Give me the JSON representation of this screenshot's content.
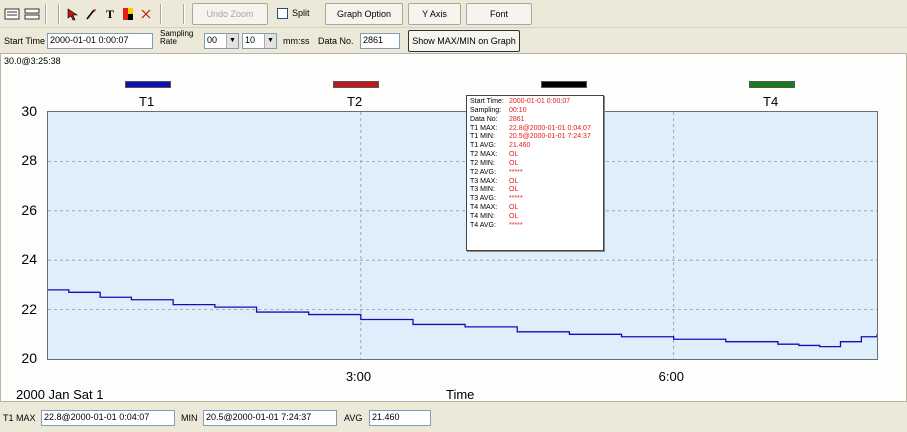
{
  "toolbar": {
    "undo_zoom": "Undo Zoom",
    "split": "Split",
    "graph_option": "Graph Option",
    "y_axis": "Y Axis",
    "font": "Font"
  },
  "settings": {
    "start_time_label": "Start Time",
    "start_time_value": "2000-01-01 0:00:07",
    "sampling_rate_label": "Sampling Rate",
    "rate_minutes": "00",
    "rate_seconds": "10",
    "rate_unit": "mm:ss",
    "data_no_label": "Data No.",
    "data_no_value": "2861",
    "show_maxmin": "Show MAX/MIN on Graph"
  },
  "graph": {
    "cursor_readout": "30.0@3:25:38",
    "legend": [
      {
        "label": "T1",
        "color": "#1010b8"
      },
      {
        "label": "T2",
        "color": "#c01818"
      },
      {
        "label": "",
        "color": "#000000"
      },
      {
        "label": "T4",
        "color": "#1b7a1b"
      }
    ],
    "date_label": "2000 Jan Sat 1",
    "x_title": "Time"
  },
  "chart_data": {
    "type": "line",
    "title": "",
    "xlabel": "Time",
    "ylabel": "",
    "ylim": [
      20,
      30
    ],
    "yticks": [
      "30",
      "28",
      "26",
      "24",
      "22",
      "20"
    ],
    "xticks": [
      "3:00",
      "6:00"
    ],
    "x_range_hours": [
      0.0,
      7.95
    ],
    "grid": true,
    "series": [
      {
        "name": "T1",
        "color": "#1010b8",
        "x_hours": [
          0.0,
          0.2,
          0.5,
          0.8,
          1.2,
          1.6,
          2.0,
          2.5,
          3.0,
          3.5,
          4.0,
          4.5,
          5.0,
          5.5,
          6.0,
          6.5,
          7.0,
          7.2,
          7.4,
          7.6,
          7.8,
          7.95
        ],
        "values": [
          22.8,
          22.7,
          22.5,
          22.4,
          22.2,
          22.1,
          21.9,
          21.8,
          21.6,
          21.4,
          21.3,
          21.1,
          21.0,
          20.9,
          20.8,
          20.7,
          20.6,
          20.55,
          20.5,
          20.7,
          20.9,
          21.0
        ]
      }
    ]
  },
  "popup": {
    "rows": [
      {
        "k": "Start Time:",
        "v": "2000-01-01 0:00:07"
      },
      {
        "k": "Sampling:",
        "v": "00:10"
      },
      {
        "k": "Data No:",
        "v": "2861"
      },
      {
        "k": "T1 MAX:",
        "v": "22.8@2000-01-01 0:04:07"
      },
      {
        "k": "T1 MIN:",
        "v": "20.5@2000-01-01 7:24:37"
      },
      {
        "k": "T1 AVG:",
        "v": "21.460"
      },
      {
        "k": "T2 MAX:",
        "v": "OL"
      },
      {
        "k": "T2 MIN:",
        "v": "OL"
      },
      {
        "k": "T2 AVG:",
        "v": "*****"
      },
      {
        "k": "T3 MAX:",
        "v": "OL"
      },
      {
        "k": "T3 MIN:",
        "v": "OL"
      },
      {
        "k": "T3 AVG:",
        "v": "*****"
      },
      {
        "k": "T4 MAX:",
        "v": "OL"
      },
      {
        "k": "T4 MIN:",
        "v": "OL"
      },
      {
        "k": "T4 AVG:",
        "v": "*****"
      }
    ]
  },
  "status": {
    "max_label": "T1 MAX",
    "max_value": "22.8@2000-01-01 0:04:07",
    "min_label": "MIN",
    "min_value": "20.5@2000-01-01 7:24:37",
    "avg_label": "AVG",
    "avg_value": "21.460"
  }
}
